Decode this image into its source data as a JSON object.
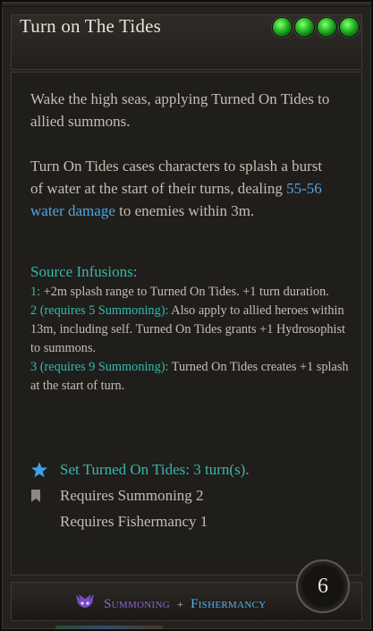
{
  "skill": {
    "title": "Turn on The Tides",
    "ap_orbs": 4,
    "description": [
      "Wake the high seas, applying Turned On Tides to allied summons."
    ],
    "effect_before": "Turn On Tides cases characters to splash a burst of water at the start of their turns, dealing ",
    "damage": "55-56 water damage",
    "effect_after": " to enemies within 3m."
  },
  "infusions": {
    "title": "Source Infusions:",
    "items": [
      {
        "label": "1:",
        "text": " +2m splash range to Turned On Tides. +1 turn duration."
      },
      {
        "label": "2 (requires 5 Summoning):",
        "text": " Also apply to allied heroes within 13m, including self. Turned On Tides grants +1 Hydrosophist to summons."
      },
      {
        "label": "3 (requires 9 Summoning):",
        "text": " Turned On Tides creates +1 splash at the start of turn."
      }
    ]
  },
  "requirements": {
    "status": "Set Turned On Tides: 3 turn(s).",
    "req1": "Requires Summoning 2",
    "req2": "Requires Fishermancy 1"
  },
  "footer": {
    "school1": "Summoning",
    "plus": "+",
    "school2": "Fishermancy",
    "cooldown": "6"
  },
  "colors": {
    "blue_damage": "#4fa6e6",
    "teal": "#35b9ad",
    "summoning": "#8a63c9",
    "fishermancy": "#5ab0e8"
  }
}
